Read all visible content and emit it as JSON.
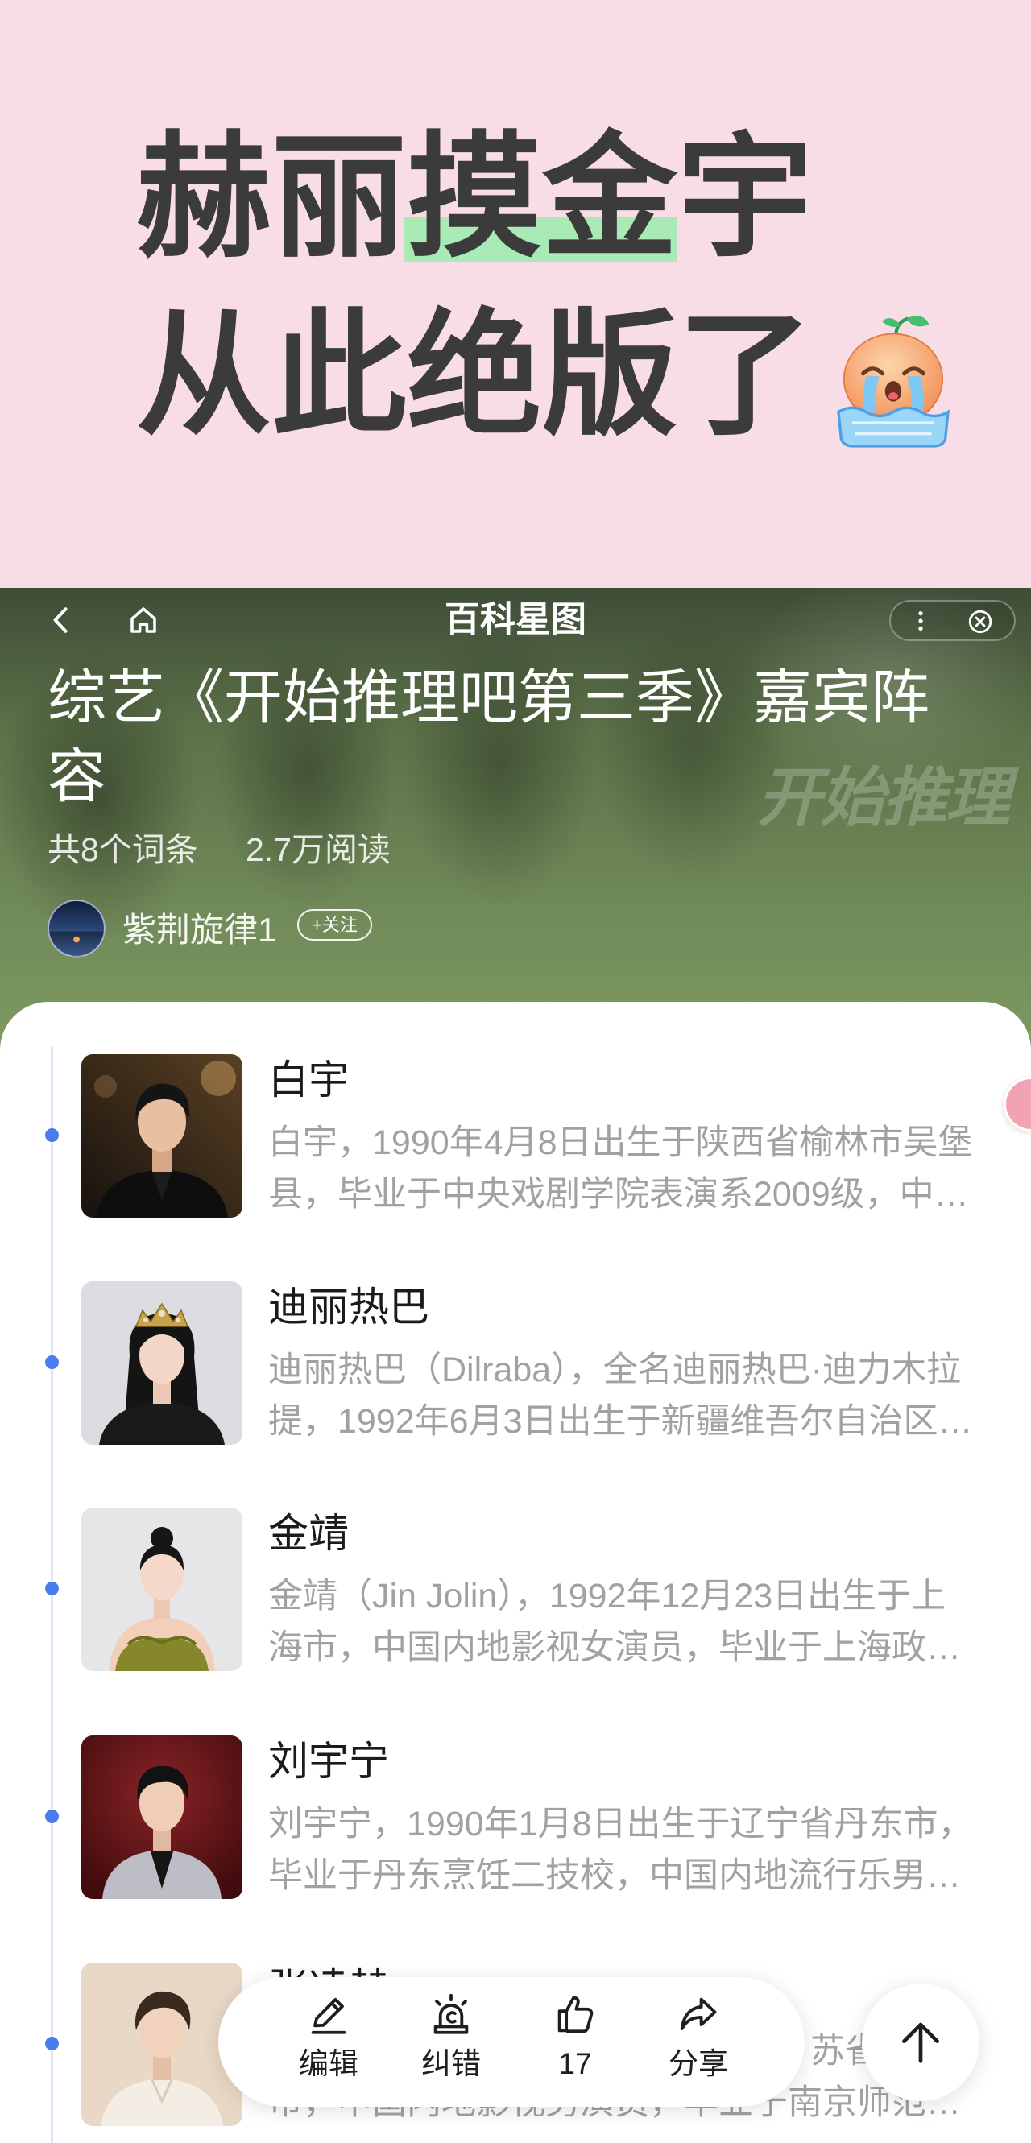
{
  "banner": {
    "line1_before": "赫丽",
    "line1_highlight": "摸金",
    "line1_after": "宇",
    "line2": "从此绝版了",
    "emoji": "crying-face-emoji"
  },
  "header": {
    "nav_title": "百科星图",
    "poster_logo": "开始推理",
    "title": "综艺《开始推理吧第三季》嘉宾阵容",
    "entry_count": "共8个词条",
    "read_count": "2.7万阅读",
    "author": {
      "name": "紫荆旋律1",
      "follow_label": "+关注"
    },
    "icons": {
      "back": "chevron-left-icon",
      "home": "home-icon",
      "more": "more-vertical-icon",
      "close": "close-circle-icon"
    }
  },
  "entries": [
    {
      "name": "白宇",
      "description_lines": [
        "白宇，1990年4月8日出生于陕西省榆林市吴堡",
        "县，毕业于中央戏剧学院表演系2009级，中…"
      ]
    },
    {
      "name": "迪丽热巴",
      "description_lines": [
        "迪丽热巴（Dilraba），全名迪丽热巴·迪力木拉",
        "提，1992年6月3日出生于新疆维吾尔自治区…"
      ]
    },
    {
      "name": "金靖",
      "description_lines": [
        "金靖（Jin Jolin），1992年12月23日出生于上",
        "海市，中国内地影视女演员，毕业于上海政…"
      ]
    },
    {
      "name": "刘宇宁",
      "description_lines": [
        "刘宇宁，1990年1月8日出生于辽宁省丹东市，",
        "毕业于丹东烹饪二技校，中国内地流行乐男…"
      ]
    },
    {
      "name": "张凌赫",
      "description_lines": [
        "苏省",
        "市，中国内地影视男演员，毕业于南京师范…"
      ]
    }
  ],
  "toolbar": {
    "edit_label": "编辑",
    "report_label": "纠错",
    "like_count": "17",
    "share_label": "分享",
    "icons": {
      "edit": "pencil-icon",
      "report": "siren-icon",
      "like": "thumbs-up-icon",
      "share": "share-arrow-icon",
      "scroll_top": "arrow-up-icon"
    }
  },
  "colors": {
    "banner_bg": "#f9dde6",
    "highlight": "#a9eab6",
    "accent": "#4a7cf0",
    "timeline": "#dbe6fa",
    "text_dark": "#3b3b3b",
    "desc_gray": "#a1a1a1",
    "header_green": "#6e8757"
  }
}
